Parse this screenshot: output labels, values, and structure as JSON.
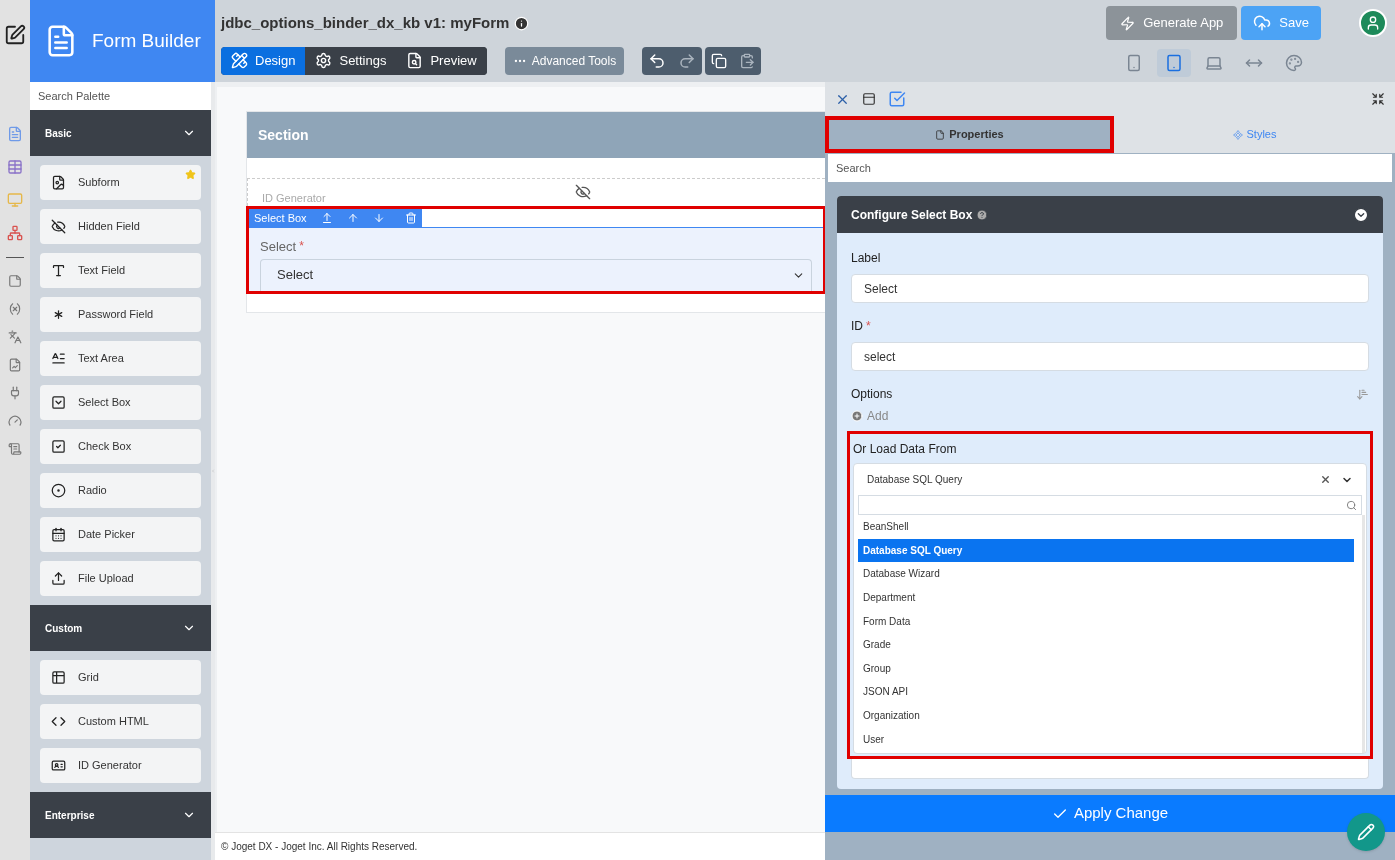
{
  "app_title": "Form Builder",
  "form_title": "jdbc_options_binder_dx_kb v1: myForm",
  "mode_tabs": [
    {
      "label": "Design",
      "selected": true
    },
    {
      "label": "Settings",
      "selected": false
    },
    {
      "label": "Preview",
      "selected": false
    }
  ],
  "advanced_tools": "Advanced Tools",
  "generate_app": "Generate App",
  "save": "Save",
  "device_buttons": [
    {
      "kind": "phone",
      "selected": false
    },
    {
      "kind": "tablet",
      "selected": true
    },
    {
      "kind": "laptop",
      "selected": false
    },
    {
      "kind": "stretch",
      "selected": false
    },
    {
      "kind": "palette",
      "selected": false
    }
  ],
  "palette": {
    "search_placeholder": "Search Palette",
    "groups": [
      {
        "title": "Basic",
        "items": [
          {
            "label": "Subform",
            "kind": "subform",
            "starred": true
          },
          {
            "label": "Hidden Field",
            "kind": "hidden",
            "starred": false
          },
          {
            "label": "Text Field",
            "kind": "text",
            "starred": false
          },
          {
            "label": "Password Field",
            "kind": "password",
            "starred": false
          },
          {
            "label": "Text Area",
            "kind": "textarea",
            "starred": false
          },
          {
            "label": "Select Box",
            "kind": "select",
            "starred": false
          },
          {
            "label": "Check Box",
            "kind": "check",
            "starred": false
          },
          {
            "label": "Radio",
            "kind": "radio",
            "starred": false
          },
          {
            "label": "Date Picker",
            "kind": "date",
            "starred": false
          },
          {
            "label": "File Upload",
            "kind": "upload",
            "starred": false
          }
        ]
      },
      {
        "title": "Custom",
        "items": [
          {
            "label": "Grid",
            "kind": "grid",
            "starred": false
          },
          {
            "label": "Custom HTML",
            "kind": "code",
            "starred": false
          },
          {
            "label": "ID Generator",
            "kind": "id",
            "starred": false
          }
        ]
      },
      {
        "title": "Enterprise"
      }
    ]
  },
  "canvas": {
    "section_title": "Section",
    "hidden_element": "ID Generator",
    "selected_element": {
      "toolbar_label": "Select Box",
      "label": "Select",
      "required_mark": "*",
      "value": "Select",
      "highlighted": true
    }
  },
  "footer": "© Joget DX - Joget Inc. All Rights Reserved.",
  "properties": {
    "tabs": [
      {
        "label": "Properties",
        "selected": true,
        "highlighted": true
      },
      {
        "label": "Styles",
        "selected": false,
        "highlighted": false
      }
    ],
    "search_placeholder": "Search",
    "card_title": "Configure Select Box",
    "fields": [
      {
        "label": "Label",
        "value": "Select"
      },
      {
        "label": "ID",
        "required_mark": "*",
        "value": "select"
      }
    ],
    "options_label": "Options",
    "add": "Add",
    "load_from": {
      "label": "Or Load Data From",
      "highlighted": true,
      "value": "Database SQL Query",
      "options": [
        {
          "label": "BeanShell",
          "selected": false
        },
        {
          "label": "Database SQL Query",
          "selected": true
        },
        {
          "label": "Database Wizard",
          "selected": false
        },
        {
          "label": "Department",
          "selected": false
        },
        {
          "label": "Form Data",
          "selected": false
        },
        {
          "label": "Grade",
          "selected": false
        },
        {
          "label": "Group",
          "selected": false
        },
        {
          "label": "JSON API",
          "selected": false
        },
        {
          "label": "Organization",
          "selected": false
        },
        {
          "label": "User",
          "selected": false
        }
      ]
    }
  },
  "apply": "Apply Change"
}
